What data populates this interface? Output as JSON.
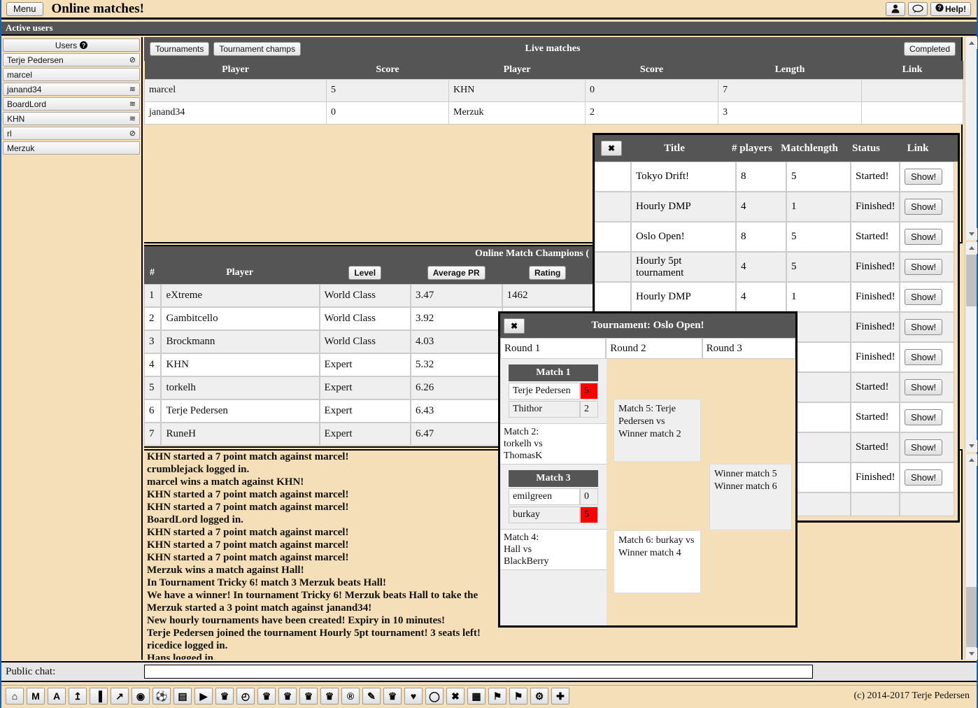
{
  "topbar": {
    "menu_label": "Menu",
    "app_title": "Online matches!",
    "help_label": "Help!",
    "profile_icon": "person-icon",
    "chat_icon": "speech-bubble-icon",
    "help_icon": "question-mark-icon"
  },
  "activeusers": {
    "title": "Active users"
  },
  "sidebar": {
    "header": "Users",
    "items": [
      {
        "name": "Terje Pedersen",
        "status": "⊘"
      },
      {
        "name": "marcel",
        "status": ""
      },
      {
        "name": "janand34",
        "status": "≋"
      },
      {
        "name": "BoardLord",
        "status": "≋"
      },
      {
        "name": "KHN",
        "status": "≋"
      },
      {
        "name": "rl",
        "status": "⊘"
      },
      {
        "name": "Merzuk",
        "status": ""
      }
    ]
  },
  "live": {
    "title": "Live matches",
    "tab_tournaments": "Tournaments",
    "tab_tournament_champs": "Tournament champs",
    "completed_label": "Completed",
    "columns": [
      "Player",
      "Score",
      "Player",
      "Score",
      "Length",
      "Link"
    ],
    "rows": [
      {
        "p1": "marcel",
        "s1": "5",
        "p2": "KHN",
        "s2": "0",
        "len": "7",
        "link": ""
      },
      {
        "p1": "janand34",
        "s1": "0",
        "p2": "Merzuk",
        "s2": "2",
        "len": "3",
        "link": ""
      }
    ]
  },
  "champions": {
    "title": "Online Match Champions (",
    "col_num": "#",
    "col_player": "Player",
    "btn_level": "Level",
    "btn_avg_pr": "Average PR",
    "btn_rating": "Rating",
    "rows": [
      {
        "n": "1",
        "player": "eXtreme",
        "level": "World Class",
        "pr": "3.47",
        "rating": "1462"
      },
      {
        "n": "2",
        "player": "Gambitcello",
        "level": "World Class",
        "pr": "3.92",
        "rating": ""
      },
      {
        "n": "3",
        "player": "Brockmann",
        "level": "World Class",
        "pr": "4.03",
        "rating": ""
      },
      {
        "n": "4",
        "player": "KHN",
        "level": "Expert",
        "pr": "5.32",
        "rating": ""
      },
      {
        "n": "5",
        "player": "torkelh",
        "level": "Expert",
        "pr": "6.26",
        "rating": ""
      },
      {
        "n": "6",
        "player": "Terje Pedersen",
        "level": "Expert",
        "pr": "6.43",
        "rating": ""
      },
      {
        "n": "7",
        "player": "RuneH",
        "level": "Expert",
        "pr": "6.47",
        "rating": ""
      }
    ]
  },
  "chatlog": {
    "lines": [
      "KHN started a 7 point match against marcel!",
      "crumblejack logged in.",
      "marcel wins a match against KHN!",
      "KHN started a 7 point match against marcel!",
      "KHN started a 7 point match against marcel!",
      "BoardLord logged in.",
      "KHN started a 7 point match against marcel!",
      "KHN started a 7 point match against marcel!",
      "KHN started a 7 point match against marcel!",
      "Merzuk wins a match against Hall!",
      "In Tournament Tricky 6! match 3 Merzuk beats Hall!",
      "We have a winner! In tournament Tricky 6! Merzuk beats Hall to take the",
      "Merzuk started a 3 point match against janand34!",
      "New hourly tournaments have been created! Expiry in 10 minutes!",
      "Terje Pedersen joined the tournament Hourly 5pt tournament! 3 seats left!",
      "ricedice logged in.",
      "Hans logged in."
    ]
  },
  "tournament_list": {
    "close_label": "✖",
    "columns": [
      "Title",
      "# players",
      "Matchlength",
      "Status",
      "Link"
    ],
    "show_label": "Show!",
    "rows": [
      {
        "title": "Tokyo Drift!",
        "players": "8",
        "matchlength": "5",
        "status": "Started!",
        "link": "Show!"
      },
      {
        "title": "Hourly DMP",
        "players": "4",
        "matchlength": "1",
        "status": "Finished!",
        "link": "Show!"
      },
      {
        "title": "Oslo Open!",
        "players": "8",
        "matchlength": "5",
        "status": "Started!",
        "link": "Show!"
      },
      {
        "title": "Hourly 5pt tournament",
        "players": "4",
        "matchlength": "5",
        "status": "Finished!",
        "link": "Show!"
      },
      {
        "title": "Hourly DMP",
        "players": "4",
        "matchlength": "1",
        "status": "Finished!",
        "link": "Show!"
      },
      {
        "title": "",
        "players": "",
        "matchlength": "",
        "status": "Finished!",
        "link": "Show!"
      },
      {
        "title": "",
        "players": "",
        "matchlength": "",
        "status": "Finished!",
        "link": "Show!"
      },
      {
        "title": "",
        "players": "",
        "matchlength": "",
        "status": "Started!",
        "link": "Show!"
      },
      {
        "title": "",
        "players": "",
        "matchlength": "",
        "status": "Started!",
        "link": "Show!"
      },
      {
        "title": "",
        "players": "",
        "matchlength": "",
        "status": "Started!",
        "link": "Show!"
      },
      {
        "title": "",
        "players": "",
        "matchlength": "",
        "status": "Finished!",
        "link": "Show!"
      }
    ]
  },
  "bracket": {
    "close_label": "✖",
    "title": "Tournament: Oslo Open!",
    "rounds": [
      "Round 1",
      "Round 2",
      "Round 3"
    ],
    "match1": {
      "header": "Match 1",
      "p1": "Terje Pedersen",
      "s1": "5",
      "p2": "Thithor",
      "s2": "2"
    },
    "match2": "Match 2:\ntorkelh vs\nThomasK",
    "match3": {
      "header": "Match 3",
      "p1": "emilgreen",
      "s1": "0",
      "p2": "burkay",
      "s2": "5"
    },
    "match4": "Match 4:\nHall vs\nBlackBerry",
    "match5": "Match 5:\nTerje Pedersen vs\nWinner match 2",
    "match6": "Match 6:\nburkay vs\nWinner match 4",
    "final": "Winner match 5\nWinner match 6",
    "winner_color": "#ff0000"
  },
  "publicchat": {
    "label": "Public chat:",
    "value": "",
    "placeholder": ""
  },
  "toolbar": {
    "buttons": [
      {
        "icon": "home-icon",
        "glyph": "⌂"
      },
      {
        "icon": "m-letter-icon",
        "glyph": "M"
      },
      {
        "icon": "a-letter-icon",
        "glyph": "A"
      },
      {
        "icon": "upload-icon",
        "glyph": "↥"
      },
      {
        "icon": "bar-chart-icon",
        "glyph": "▐"
      },
      {
        "icon": "line-chart-icon",
        "glyph": "↗"
      },
      {
        "icon": "eye-icon",
        "glyph": "◉"
      },
      {
        "icon": "soccer-ball-icon",
        "glyph": "⚽"
      },
      {
        "icon": "archive-box-icon",
        "glyph": "▤"
      },
      {
        "icon": "play-icon",
        "glyph": "▶"
      },
      {
        "icon": "trophy-icon",
        "glyph": "♛"
      },
      {
        "icon": "clock-icon",
        "glyph": "◴"
      },
      {
        "icon": "trophy-icon",
        "glyph": "♛"
      },
      {
        "icon": "trophy-icon",
        "glyph": "♛"
      },
      {
        "icon": "trophy-icon",
        "glyph": "♛"
      },
      {
        "icon": "trophy-icon",
        "glyph": "♛"
      },
      {
        "icon": "registered-icon",
        "glyph": "®"
      },
      {
        "icon": "edit-icon",
        "glyph": "✎"
      },
      {
        "icon": "trophy-icon",
        "glyph": "♛"
      },
      {
        "icon": "heart-icon",
        "glyph": "♥"
      },
      {
        "icon": "speech-bubble-icon",
        "glyph": "◯"
      },
      {
        "icon": "close-x-icon",
        "glyph": "✖"
      },
      {
        "icon": "film-strip-icon",
        "glyph": "▦"
      },
      {
        "icon": "bookmark-icon",
        "glyph": "⚑"
      },
      {
        "icon": "bookmark-icon",
        "glyph": "⚑"
      },
      {
        "icon": "settings-gears-icon",
        "glyph": "⚙"
      },
      {
        "icon": "plus-icon",
        "glyph": "✚"
      }
    ],
    "copyright": "(c) 2014-2017 Terje Pedersen"
  }
}
